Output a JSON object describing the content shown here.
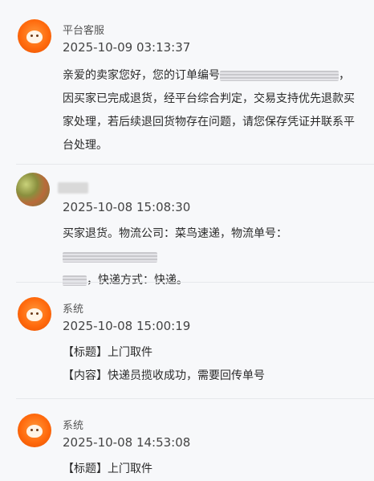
{
  "messages": [
    {
      "sender": "平台客服",
      "time": "2025-10-09 03:13:37",
      "body_parts": {
        "p1": "亲爱的卖家您好，您的订单编号",
        "p2": "，因买家已完成退货，经平台综合判定，交易支持优先退款买家处理，若后续退回货物存在问题，请您保存凭证并联系平台处理。"
      }
    },
    {
      "sender": "",
      "time": "2025-10-08 15:08:30",
      "body_parts": {
        "p1": "买家退货。物流公司：菜鸟速递，物流单号：",
        "p2": "，快递方式：快递。"
      }
    },
    {
      "sender": "系统",
      "time": "2025-10-08 15:00:19",
      "lines": [
        "【标题】上门取件",
        "【内容】快递员揽收成功，需要回传单号"
      ]
    },
    {
      "sender": "系统",
      "time": "2025-10-08 14:53:08",
      "lines": [
        "【标题】上门取件"
      ]
    }
  ]
}
